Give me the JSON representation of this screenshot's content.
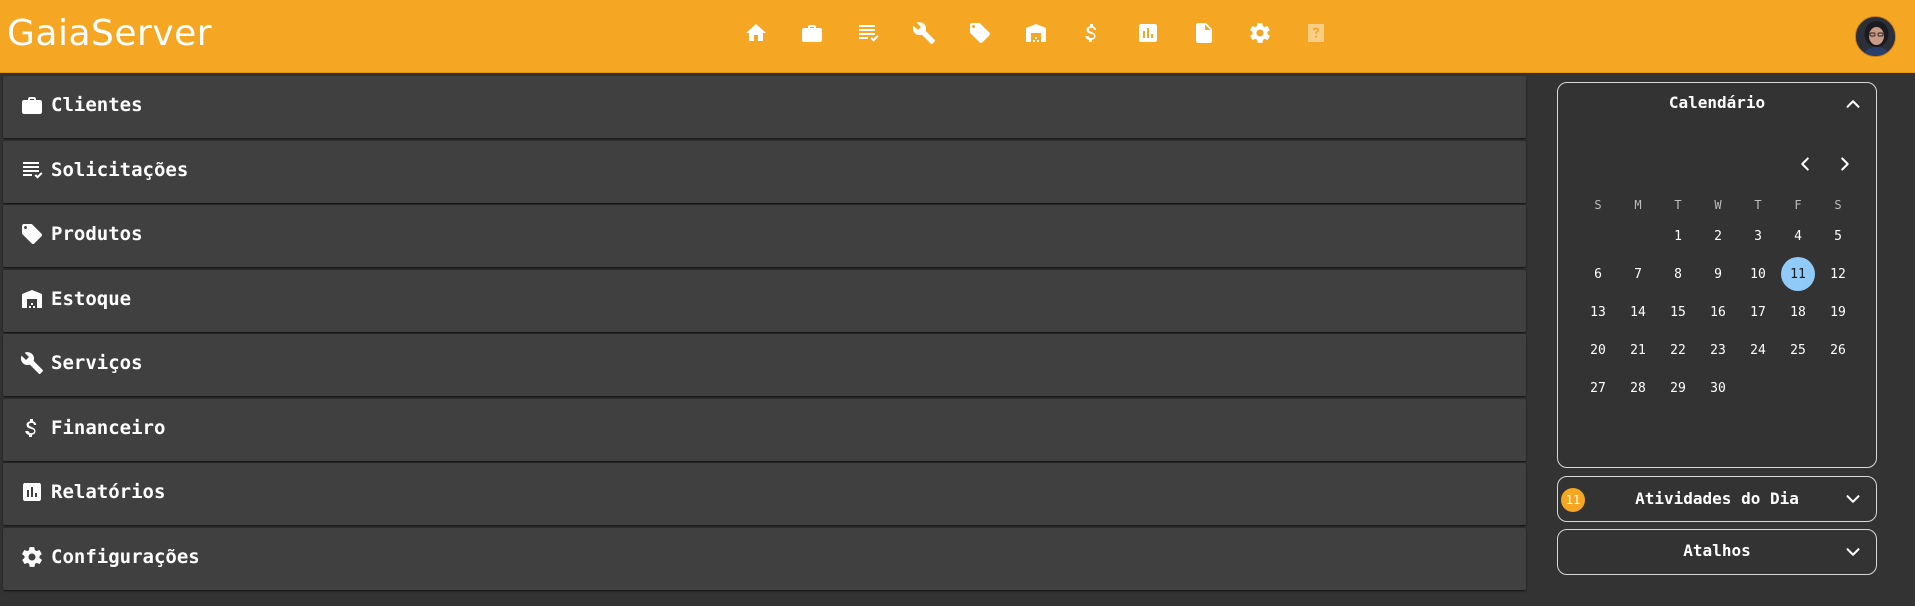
{
  "app": {
    "brand": "GaiaServer"
  },
  "topnav": [
    {
      "name": "home-icon"
    },
    {
      "name": "briefcase-icon"
    },
    {
      "name": "checklist-icon"
    },
    {
      "name": "wrench-icon"
    },
    {
      "name": "tag-icon"
    },
    {
      "name": "warehouse-icon"
    },
    {
      "name": "dollar-icon"
    },
    {
      "name": "chart-icon"
    },
    {
      "name": "document-icon"
    },
    {
      "name": "gear-icon"
    },
    {
      "name": "help-icon"
    }
  ],
  "panels": [
    {
      "label": "Clientes",
      "icon": "briefcase-icon"
    },
    {
      "label": "Solicitações",
      "icon": "checklist-icon"
    },
    {
      "label": "Produtos",
      "icon": "tag-icon"
    },
    {
      "label": "Estoque",
      "icon": "warehouse-icon"
    },
    {
      "label": "Serviços",
      "icon": "wrench-icon"
    },
    {
      "label": "Financeiro",
      "icon": "dollar-icon"
    },
    {
      "label": "Relatórios",
      "icon": "chart-icon"
    },
    {
      "label": "Configurações",
      "icon": "gear-icon"
    }
  ],
  "calendar": {
    "title": "Calendário",
    "weekdays": [
      "S",
      "M",
      "T",
      "W",
      "T",
      "F",
      "S"
    ],
    "leading_blanks": 2,
    "days": [
      "1",
      "2",
      "3",
      "4",
      "5",
      "6",
      "7",
      "8",
      "9",
      "10",
      "11",
      "12",
      "13",
      "14",
      "15",
      "16",
      "17",
      "18",
      "19",
      "20",
      "21",
      "22",
      "23",
      "24",
      "25",
      "26",
      "27",
      "28",
      "29",
      "30"
    ],
    "today": "11",
    "today_color": "#90caf9"
  },
  "activities": {
    "title": "Atividades do Dia",
    "count": "11"
  },
  "shortcuts": {
    "title": "Atalhos"
  },
  "colors": {
    "accent": "#f5a623",
    "background": "#333333",
    "panel": "#404040"
  }
}
